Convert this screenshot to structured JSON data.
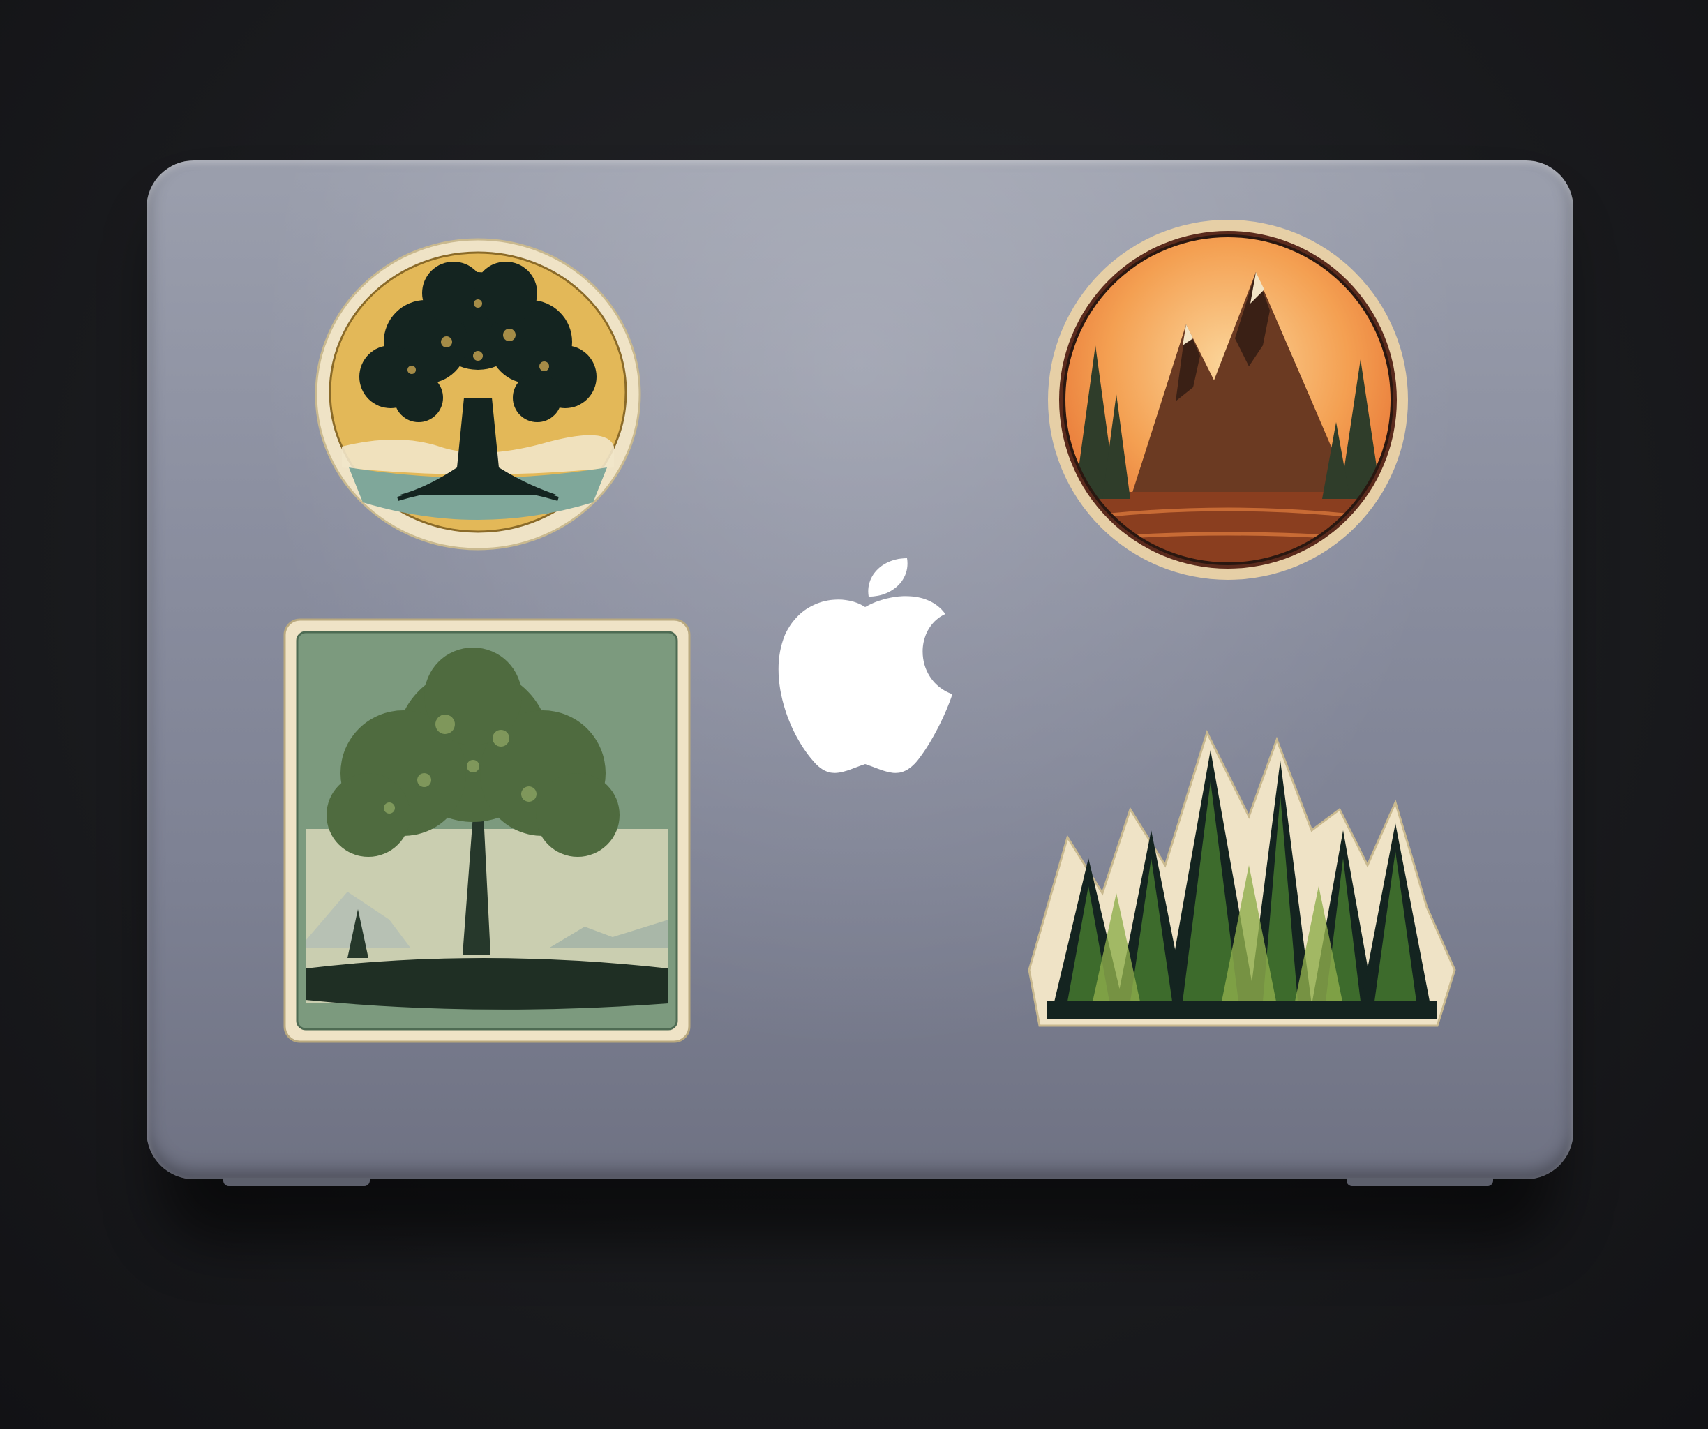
{
  "scene": {
    "description_label": "",
    "colors": {
      "background": "#1b1c1f",
      "laptop_lid": "#8b8fa0",
      "sticker_paper": "#efe3c6",
      "ink": "#142420"
    }
  },
  "stickers": [
    {
      "name": "tree-of-life-sticker",
      "shape": "round",
      "palette": [
        "#e3b858",
        "#142420",
        "#7fa79a"
      ]
    },
    {
      "name": "mountain-sunset-sticker",
      "shape": "round",
      "palette": [
        "#f4a052",
        "#6b3a22",
        "#2f3d2a"
      ]
    },
    {
      "name": "oak-tree-poster-sticker",
      "shape": "square",
      "palette": [
        "#7c9a7e",
        "#4f6b3f",
        "#d8d7b8"
      ]
    },
    {
      "name": "pine-forest-sticker",
      "shape": "die-cut",
      "palette": [
        "#3d6b2c",
        "#8fae4c",
        "#142420"
      ]
    }
  ],
  "logo": {
    "icon": "apple-logo-icon",
    "color": "#ffffff"
  }
}
